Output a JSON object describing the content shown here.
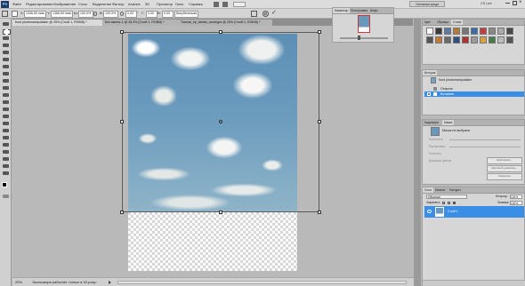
{
  "app": {
    "logo": "Ps"
  },
  "menu": [
    "Файл",
    "Редактирование",
    "Изображение",
    "Слои",
    "Выделение",
    "Фильтр",
    "Анализ",
    "3D",
    "Просмотр",
    "Окно",
    "Справка"
  ],
  "options": {
    "x_value": "1336,50 пикс",
    "y_value": "1366,50 пикс",
    "w_value": "100,0%",
    "h_value": "100,0%",
    "angle_value": "0,00",
    "h_skew": "0,00",
    "v_skew": "0,00",
    "interp": "Бикубическая"
  },
  "topright": {
    "workspace": "Основная среда",
    "cslive": "CS Live"
  },
  "tabs": [
    {
      "label": "fond photomanipulation @ 25% (Слой 1, RGB/8) *"
    },
    {
      "label": "Без имени-1 @ 33,3% (Слой 1, RGB/8) *"
    },
    {
      "label": "Tutorial_by_tabtab_nicolegra @ 25% (Слой 1, RGB/8) *"
    }
  ],
  "status": {
    "zoom": "25%",
    "text": "Экспозиция работает только в 32-разр."
  },
  "navigator": {
    "tabs": [
      "Навигатор",
      "Гистограмма",
      "Инфо"
    ]
  },
  "swatches": {
    "tabs": [
      "Цвет",
      "Образцы",
      "Стили"
    ]
  },
  "history": {
    "tabs": [
      "История"
    ],
    "document": "fond photomanipulation",
    "items": [
      "Открыть",
      "Вставить"
    ]
  },
  "adjust": {
    "tabs": [
      "Коррекция",
      "Маски"
    ],
    "title": "Маска не выбрана",
    "rows": [
      "Плотность:",
      "Растушевка:",
      "Уточнить:",
      "Диапазон цветов:"
    ],
    "buttons": [
      "Край маски...",
      "Цветовой диапазон...",
      "Инверсия"
    ]
  },
  "layers": {
    "tabs": [
      "Слои",
      "Каналы",
      "Контуры"
    ],
    "blend": "Обычные",
    "opacity_label": "Непрозр.:",
    "opacity": "100%",
    "lock_label": "Закрепить:",
    "fill_label": "Заливка:",
    "fill": "100%",
    "items": [
      {
        "name": "Слой 1"
      }
    ]
  }
}
